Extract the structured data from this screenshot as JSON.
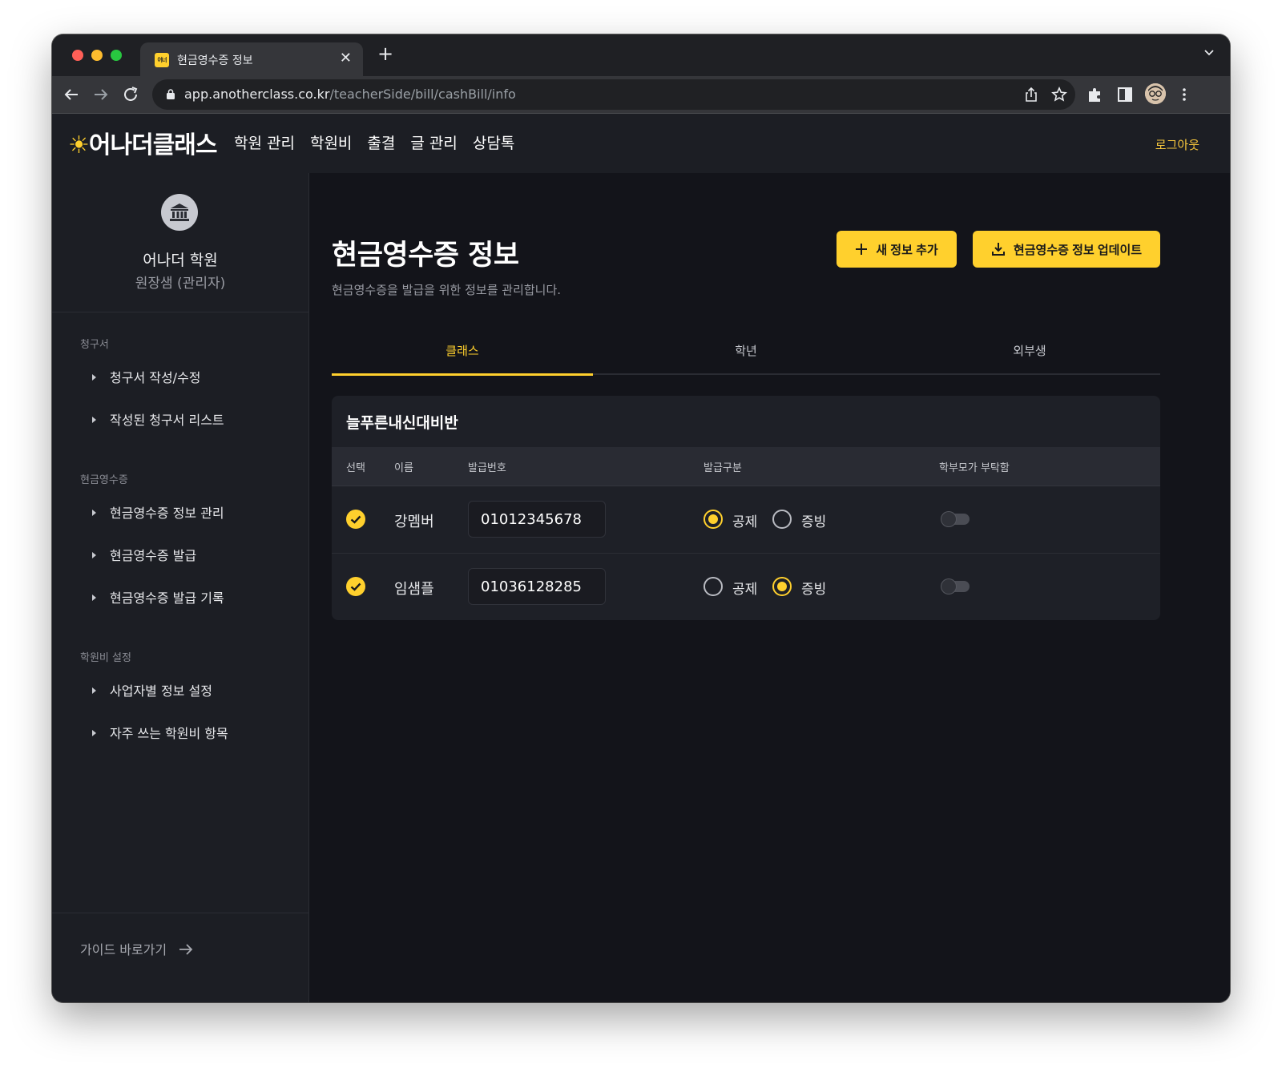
{
  "browser": {
    "tab_title": "현금영수증 정보",
    "favicon_text": "어너",
    "url_host": "app.anotherclass.co.kr",
    "url_path": "/teacherSide/bill/cashBill/info"
  },
  "header": {
    "logo": "어나더클래스",
    "nav": [
      "학원 관리",
      "학원비",
      "출결",
      "글 관리",
      "상담톡"
    ],
    "logout": "로그아웃"
  },
  "sidebar": {
    "org_name": "어나더 학원",
    "org_role": "원장샘 (관리자)",
    "sections": [
      {
        "title": "청구서",
        "items": [
          "청구서 작성/수정",
          "작성된 청구서 리스트"
        ]
      },
      {
        "title": "현금영수증",
        "items": [
          "현금영수증 정보 관리",
          "현금영수증 발급",
          "현금영수증 발급 기록"
        ]
      },
      {
        "title": "학원비 설정",
        "items": [
          "사업자별 정보 설정",
          "자주 쓰는 학원비 항목"
        ]
      }
    ],
    "guide_link": "가이드 바로가기"
  },
  "main": {
    "title": "현금영수증 정보",
    "description": "현금영수증을 발급을 위한 정보를 관리합니다.",
    "add_button": "새 정보 추가",
    "update_button": "현금영수증 정보 업데이트",
    "tabs": [
      "클래스",
      "학년",
      "외부생"
    ],
    "active_tab": "클래스"
  },
  "card": {
    "title": "늘푸른내신대비반",
    "columns": [
      "선택",
      "이름",
      "발급번호",
      "발급구분",
      "학부모가 부탁함"
    ],
    "rows": [
      {
        "selected": true,
        "name": "강멤버",
        "number": "01012345678",
        "type": "공제",
        "parent_request": false
      },
      {
        "selected": true,
        "name": "임샘플",
        "number": "01036128285",
        "type": "증빙",
        "parent_request": false
      }
    ],
    "type_options": [
      "공제",
      "증빙"
    ]
  },
  "colors": {
    "accent": "#ffd02d",
    "background": "#13141a",
    "panel": "#1c1e24"
  },
  "icons": [
    "plus-icon",
    "download-icon",
    "bank-icon",
    "check-circle-icon",
    "arrow-right-icon"
  ]
}
